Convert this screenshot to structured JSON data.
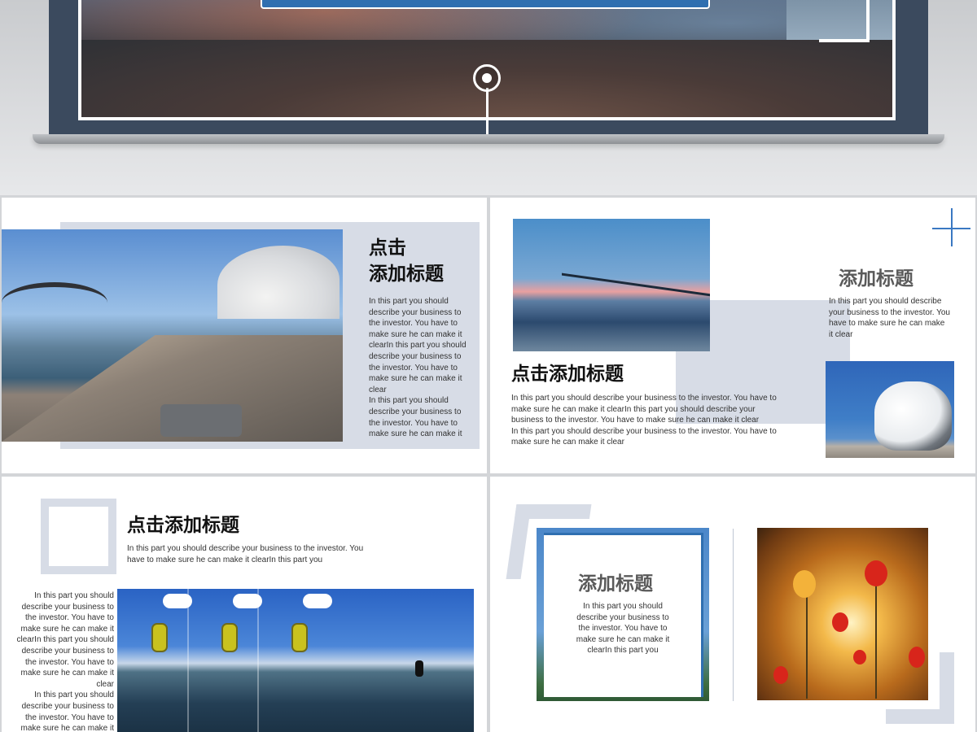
{
  "slide1": {
    "title": "点击\n添加标题",
    "body": "In this part you should describe your business to the investor. You have to make sure he can make it clearIn this part you should describe your business to the investor. You have to make sure he can make it clear\nIn this part you should describe your business to the investor. You have to make sure he can make it"
  },
  "slide2": {
    "title_main": "点击添加标题",
    "body_main": "In this part you should describe your business to the investor. You have to make sure he can make it clearIn this part you should describe your business to the investor. You have to make sure he can make it clear\nIn this part you should describe your business to the investor. You have to make sure he can make it clear",
    "title_side": "添加标题",
    "body_side": "In this part you should describe your business to the investor. You have to make sure he can make it clear"
  },
  "slide3": {
    "title": "点击添加标题",
    "body_top": "In this part you should describe your business to the investor. You have to make sure he can make it clearIn this part you",
    "body_left": "In this part you should describe your business to the investor. You have to make sure he can make it clearIn this part you should describe your business to the investor. You have to make sure he can make it clear\nIn this part you should describe your business to the investor. You have to make sure he can make it"
  },
  "slide4": {
    "title": "添加标题",
    "body": "In this part you should describe your business to the investor. You have to make sure he can make it clearIn this part you"
  },
  "colors": {
    "accent_blue": "#2f6fb0",
    "panel_grey": "#d7dce6",
    "frame_dark": "#3b4a5e"
  }
}
